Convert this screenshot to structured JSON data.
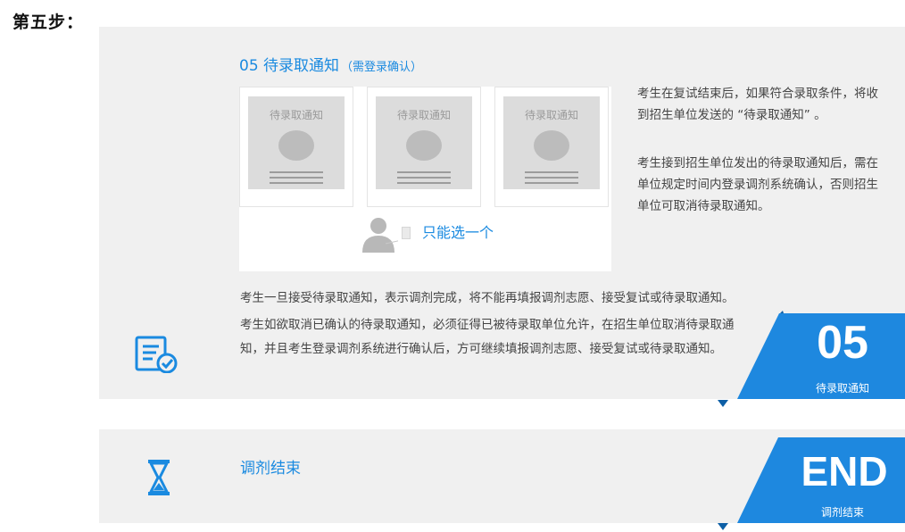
{
  "page": {
    "step_label": "第五步："
  },
  "step05": {
    "title": "05 待录取通知",
    "title_note": "（需登录确认）",
    "card_title": "待录取通知",
    "pick_text": "只能选一个",
    "desc_paragraphs": [
      "考生在复试结束后，如果符合录取条件，将收到招生单位发送的 “待录取通知” 。",
      "考生接到招生单位发出的待录取通知后，需在单位规定时间内登录调剂系统确认，否则招生单位可取消待录取通知。"
    ],
    "note_line": "考生一旦接受待录取通知，表示调剂完成，将不能再填报调剂志愿、接受复试或待录取通知。",
    "cancel_paragraph": "考生如欲取消已确认的待录取通知，必须征得已被待录取单位允许，在招生单位取消待录取通知，并且考生登录调剂系统进行确认后，方可继续填报调剂志愿、接受复试或待录取通知。",
    "badge_num": "05",
    "badge_label": "待录取通知",
    "icon": "document-check-icon"
  },
  "end": {
    "title": "调剂结束",
    "badge_num": "END",
    "badge_label": "调剂结束",
    "icon": "hourglass-icon"
  },
  "colors": {
    "accent": "#1a8ae0",
    "badge": "#1e88df",
    "badge_shadow": "#0d5fa6",
    "panel_bg": "#f0f0f0"
  }
}
